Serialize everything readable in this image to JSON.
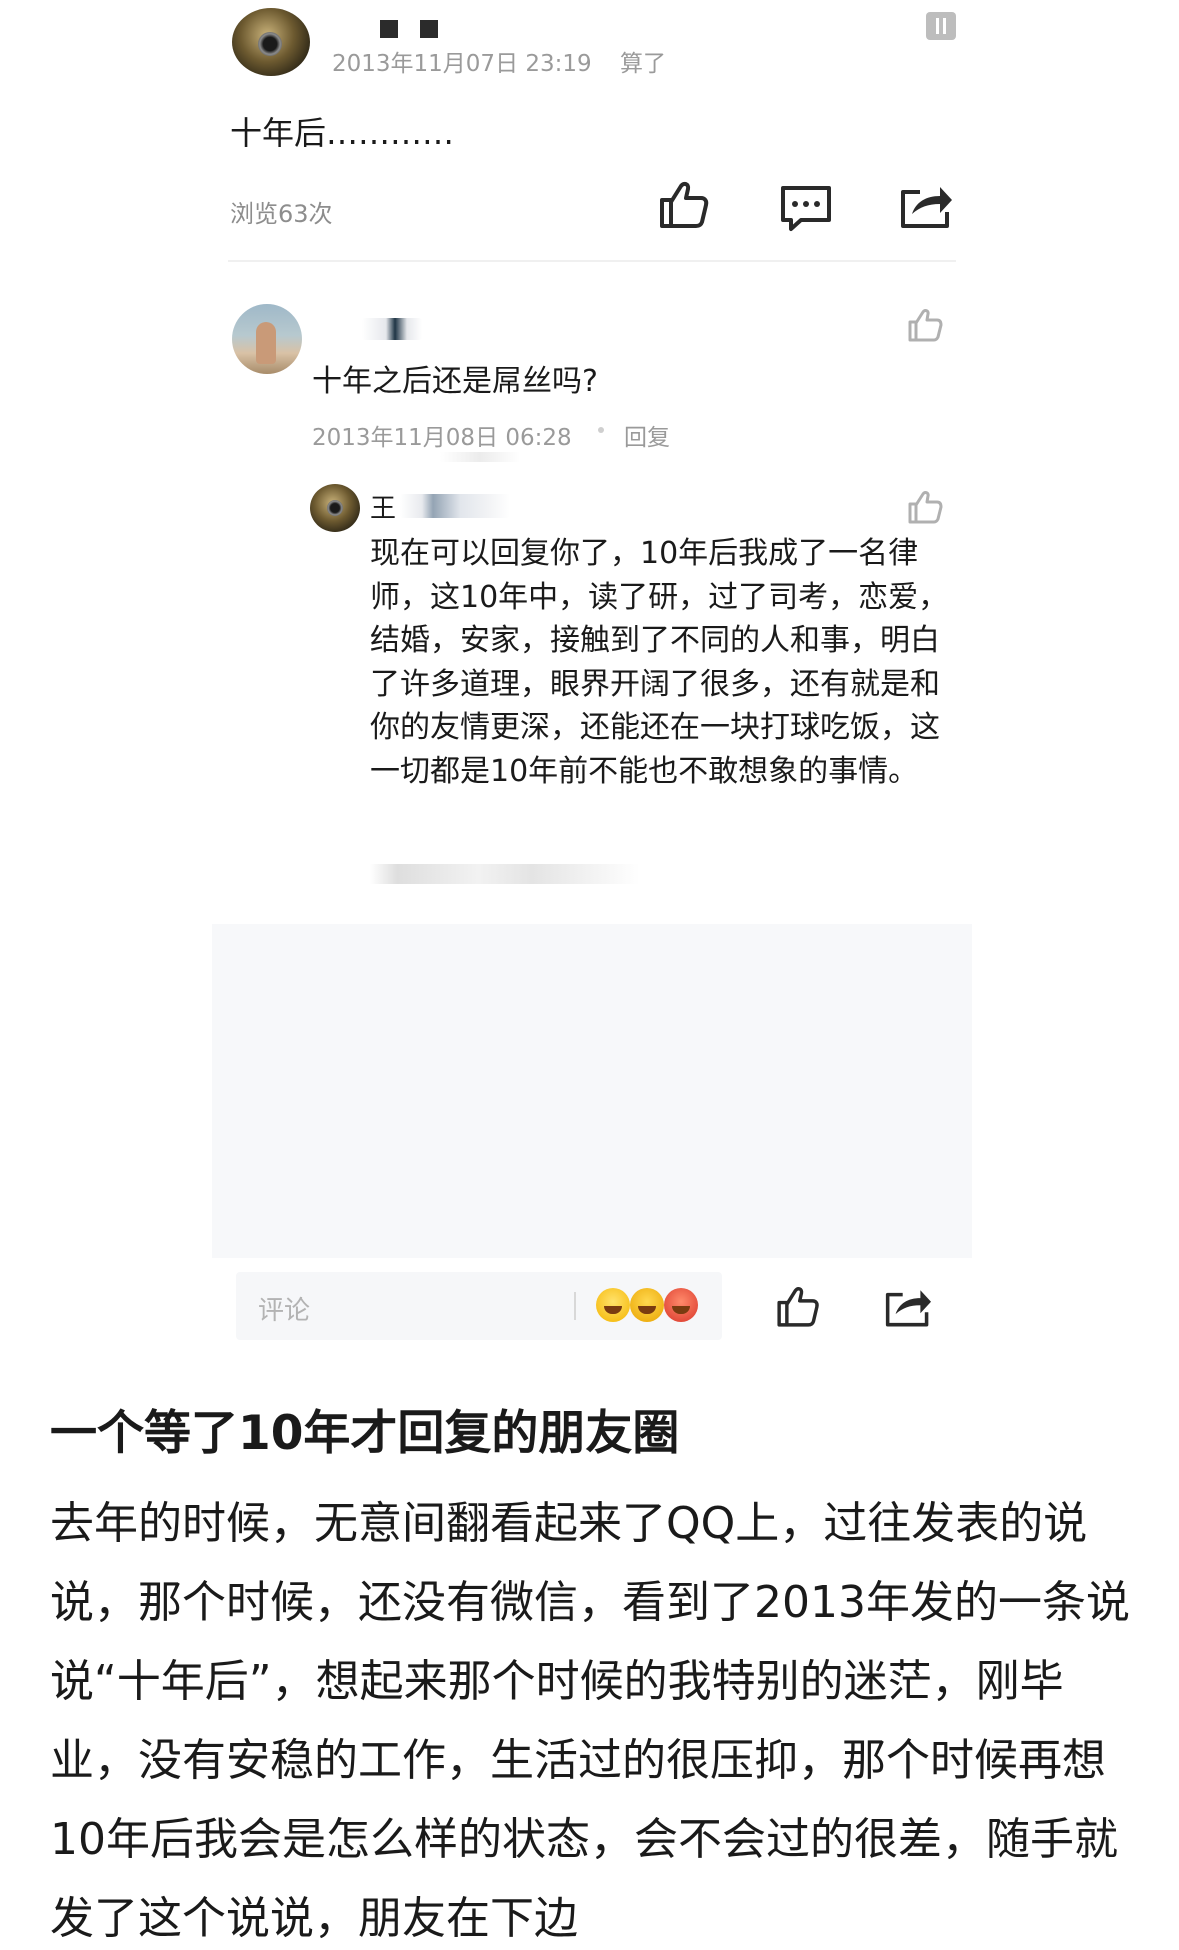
{
  "post": {
    "date_text": "2013年11月07日 23:19",
    "label": "算了",
    "body": "十年后…………",
    "views": "浏览63次"
  },
  "comment": {
    "text": "十年之后还是屌丝吗?",
    "date": "2013年11月08日 06:28",
    "reply_label": "回复"
  },
  "reply": {
    "name_initial": "王",
    "text": "现在可以回复你了，10年后我成了一名律师，这10年中，读了研，过了司考，恋爱，结婚，安家，接触到了不同的人和事，明白了许多道理，眼界开阔了很多，还有就是和你的友情更深，还能还在一块打球吃饭，这一切都是10年前不能也不敢想象的事情。"
  },
  "comment_bar": {
    "placeholder": "评论"
  },
  "article": {
    "title": "一个等了10年才回复的朋友圈",
    "body": "去年的时候，无意间翻看起来了QQ上，过往发表的说说，那个时候，还没有微信，看到了2013年发的一条说说“十年后”，想起来那个时候的我特别的迷茫，刚毕业，没有安稳的工作，生活过的很压抑，那个时候再想10年后我会是怎么样的状态，会不会过的很差，随手就发了这个说说，朋友在下边"
  }
}
